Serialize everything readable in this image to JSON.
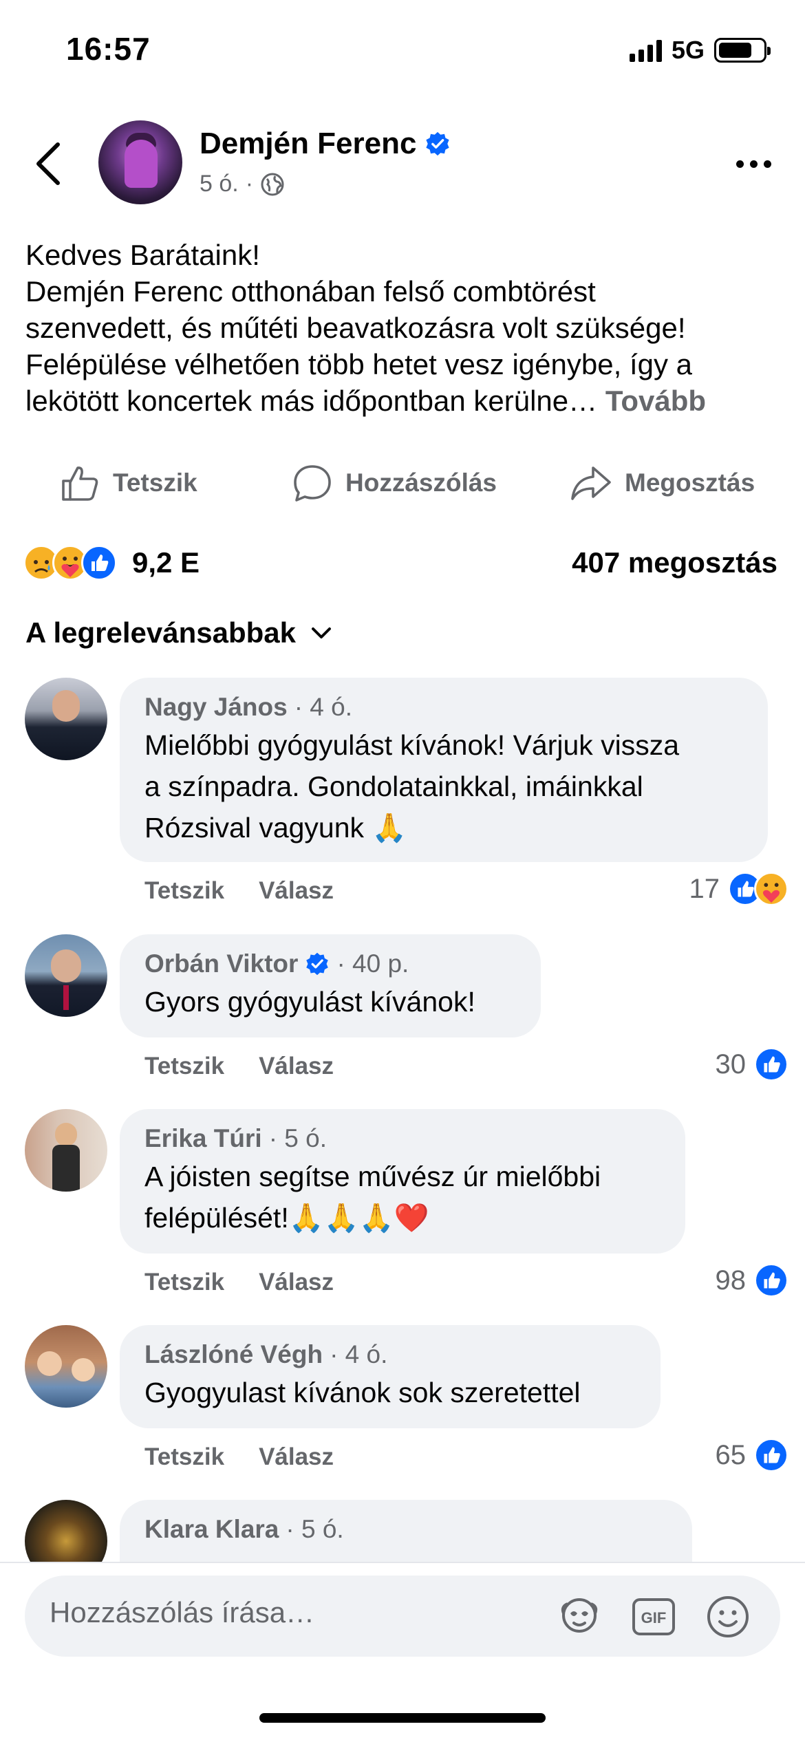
{
  "status_bar": {
    "time": "16:57",
    "network": "5G",
    "battery_level": 0.75
  },
  "header": {
    "author": "Demjén Ferenc",
    "verified": true,
    "time_ago": "5 ó.",
    "separator": "·",
    "audience_icon": "globe-icon"
  },
  "post": {
    "lines": [
      "Kedves Barátaink!",
      "Demjén Ferenc otthonában felső combtörést",
      "szenvedett, és műtéti beavatkozásra volt szüksége!",
      "Felépülése vélhetően több hetet vesz igénybe, így a",
      "lekötött koncertek más időpontban kerülne…"
    ],
    "see_more": "Tovább"
  },
  "actions": {
    "like": "Tetszik",
    "comment": "Hozzászólás",
    "share": "Megosztás"
  },
  "stats": {
    "reactions": [
      "sad",
      "care",
      "like"
    ],
    "reaction_count": "9,2 E",
    "shares": "407 megosztás"
  },
  "sort": {
    "label": "A legrelevánsabbak"
  },
  "comments": [
    {
      "name": "Nagy János",
      "verified": false,
      "time": "· 4 ó.",
      "lines": [
        "Mielőbbi gyógyulást kívánok! Várjuk vissza",
        "a színpadra. Gondolatainkkal, imáinkkal",
        "Rózsival vagyunk 🙏"
      ],
      "like_label": "Tetszik",
      "reply_label": "Válasz",
      "reaction_count": "17",
      "reactions": [
        "like",
        "care"
      ]
    },
    {
      "name": "Orbán Viktor",
      "verified": true,
      "time": "· 40 p.",
      "lines": [
        "Gyors gyógyulást kívánok!"
      ],
      "like_label": "Tetszik",
      "reply_label": "Válasz",
      "reaction_count": "30",
      "reactions": [
        "like"
      ]
    },
    {
      "name": "Erika Túri",
      "verified": false,
      "time": "· 5 ó.",
      "lines": [
        "A jóisten segítse művész úr mielőbbi",
        "felépülését!🙏🙏🙏❤️"
      ],
      "like_label": "Tetszik",
      "reply_label": "Válasz",
      "reaction_count": "98",
      "reactions": [
        "like"
      ]
    },
    {
      "name": "Lászlóné Végh",
      "verified": false,
      "time": "· 4 ó.",
      "lines": [
        "Gyogyulast kívánok sok szeretettel"
      ],
      "like_label": "Tetszik",
      "reply_label": "Válasz",
      "reaction_count": "65",
      "reactions": [
        "like"
      ]
    },
    {
      "name": "Klara Klara",
      "verified": false,
      "time": "· 5 ó.",
      "lines": [
        ""
      ]
    }
  ],
  "composer": {
    "placeholder": "Hozzászólás írása…",
    "icons": [
      "avatar-sticker-icon",
      "gif-icon",
      "emoji-icon"
    ]
  },
  "colors": {
    "facebook_blue": "#0866ff",
    "secondary_text": "#65676b",
    "bubble_bg": "#f0f2f5"
  }
}
